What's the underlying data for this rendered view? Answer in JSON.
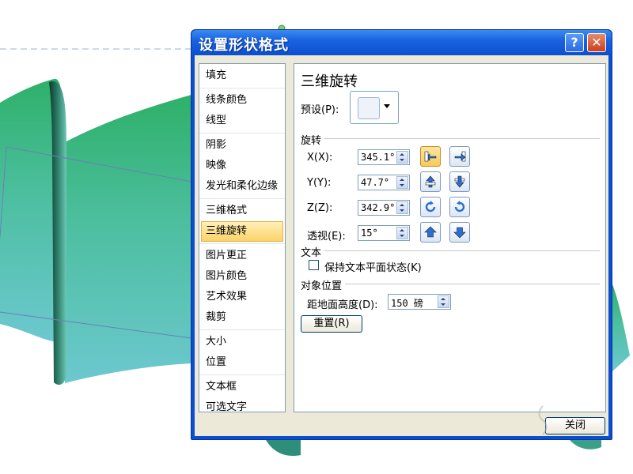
{
  "dialog": {
    "title": "设置形状格式",
    "help_label": "?",
    "close_label": "✕",
    "close_button": "关闭"
  },
  "categories": [
    [
      "填充"
    ],
    [
      "线条颜色",
      "线型"
    ],
    [
      "阴影",
      "映像",
      "发光和柔化边缘"
    ],
    [
      "三维格式",
      "三维旋转"
    ],
    [
      "图片更正",
      "图片颜色",
      "艺术效果",
      "裁剪"
    ],
    [
      "大小",
      "位置"
    ],
    [
      "文本框",
      "可选文字"
    ]
  ],
  "selected_category": "三维旋转",
  "panel": {
    "title": "三维旋转",
    "preset_label": "预设(P):",
    "rotation_heading": "旋转",
    "x_label": "X(X):",
    "x_value": "345.1°",
    "y_label": "Y(Y):",
    "y_value": "47.7°",
    "z_label": "Z(Z):",
    "z_value": "342.9°",
    "perspective_label": "透视(E):",
    "perspective_value": "15°",
    "text_heading": "文本",
    "keep_text_flat_label": "保持文本平面状态(K)",
    "keep_text_flat_checked": false,
    "object_position_heading": "对象位置",
    "distance_label": "距地面高度(D):",
    "distance_value": "150 磅",
    "reset_button": "重置(R)"
  },
  "colors": {
    "titlebar": "#0a4fd0",
    "dialog_face": "#ece9d8",
    "selected_item": "#fbd36a",
    "shape_top": "#3cb371",
    "shape_bottom": "#5fc3c6"
  }
}
